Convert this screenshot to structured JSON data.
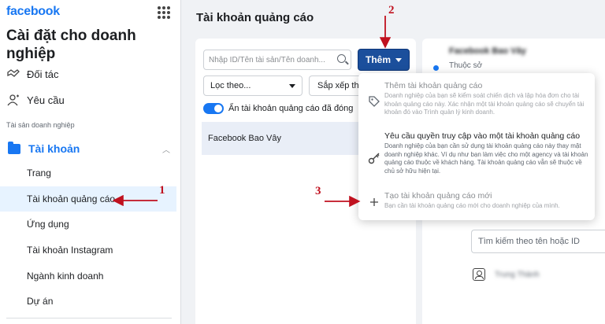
{
  "brand": "facebook",
  "sidebar": {
    "title": "Cài đặt cho doanh nghiệp",
    "partners_label": "Đối tác",
    "requests_label": "Yêu cầu",
    "assets_section": "Tài sản doanh nghiệp",
    "accounts_label": "Tài khoản",
    "items": [
      {
        "label": "Trang"
      },
      {
        "label": "Tài khoản quảng cáo"
      },
      {
        "label": "Ứng dụng"
      },
      {
        "label": "Tài khoản Instagram"
      },
      {
        "label": "Ngành kinh doanh"
      },
      {
        "label": "Dự án"
      }
    ]
  },
  "main": {
    "title": "Tài khoản quảng cáo",
    "search_placeholder": "Nhập ID/Tên tài sản/Tên doanh...",
    "add_button": "Thêm",
    "filter_label": "Lọc theo...",
    "sort_label": "Sắp xếp theo...",
    "toggle_label": "Ẩn tài khoản quảng cáo đã đóng",
    "accounts": [
      {
        "name": "Facebook Bao Vây"
      }
    ]
  },
  "right_panel": {
    "account_name": "Facebook Bao Vây",
    "owned_by": "Thuộc sở",
    "search_placeholder": "Tìm kiếm theo tên hoặc ID",
    "person_name": "Trung Thành"
  },
  "dropdown": {
    "items": [
      {
        "title": "Thêm tài khoản quảng cáo",
        "desc": "Doanh nghiệp của bạn sẽ kiểm soát chiến dịch và lập hóa đơn cho tài khoản quảng cáo này. Xác nhận một tài khoản quảng cáo sẽ chuyển tài khoản đó vào Trình quản lý kinh doanh.",
        "icon": "tag-icon"
      },
      {
        "title": "Yêu cầu quyền truy cập vào một tài khoản quảng cáo",
        "desc": "Doanh nghiệp của bạn cần sử dụng tài khoản quảng cáo này thay mặt doanh nghiệp khác. Ví dụ như bạn làm việc cho một agency và tài khoản quảng cáo thuộc về khách hàng. Tài khoản quảng cáo vẫn sẽ thuộc về chủ sở hữu hiện tại.",
        "icon": "key-icon"
      },
      {
        "title": "Tạo tài khoản quảng cáo mới",
        "desc": "Bạn cần tài khoản quảng cáo mới cho doanh nghiệp của mình.",
        "icon": "plus-icon"
      }
    ]
  },
  "annotations": {
    "one": "1",
    "two": "2",
    "three": "3"
  },
  "colors": {
    "brand": "#1877f2",
    "add_button": "#1b4f9c",
    "annotation": "#c0111f"
  }
}
